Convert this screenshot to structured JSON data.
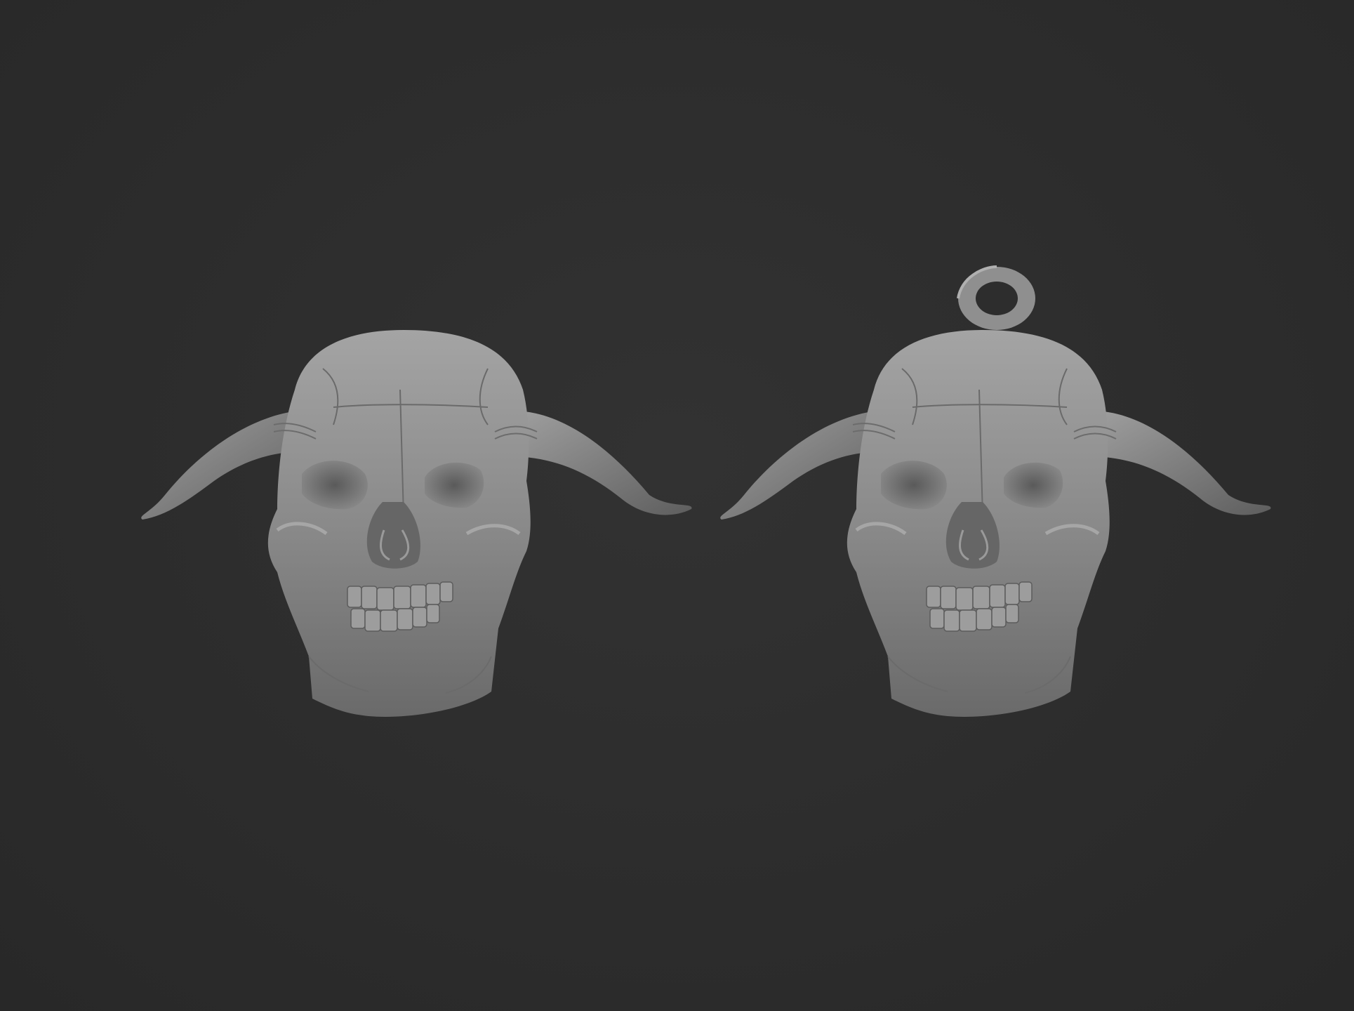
{
  "scene": {
    "background_color": "#2d2d2d",
    "material_color": "#8f8f8f",
    "models": [
      {
        "name": "horned-skull",
        "has_bail_ring": false
      },
      {
        "name": "horned-skull-pendant",
        "has_bail_ring": true
      }
    ]
  }
}
